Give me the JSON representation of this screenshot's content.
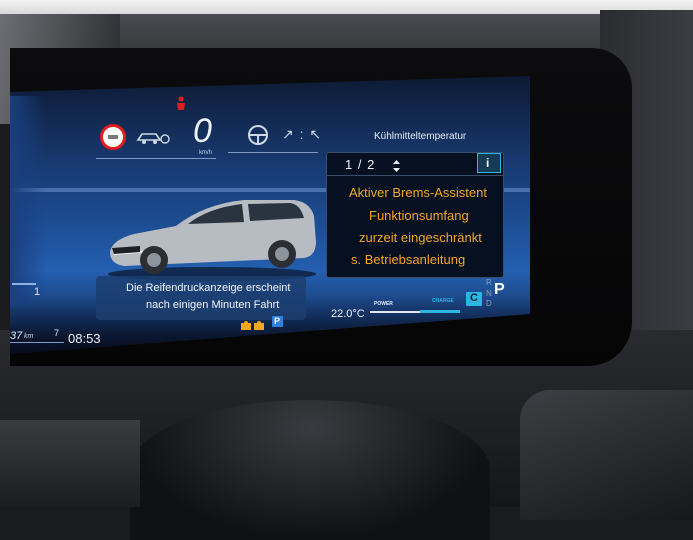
{
  "speed": {
    "value": "0",
    "unit": "km/h"
  },
  "assist_status": "↗ : ↖",
  "header_label": "Kühlmitteltemperatur",
  "message_panel": {
    "page": "1 / 2",
    "info_label": "i",
    "lines": [
      "Aktiver Brems-Assistent",
      "Funktionsumfang",
      "zurzeit eingeschränkt",
      "s. Betriebsanleitung"
    ]
  },
  "tire_notice": {
    "line1": "Die Reifendruckanzeige erscheint",
    "line2": "nach einigen Minuten Fahrt"
  },
  "odometer": {
    "left": "37",
    "unit": "km",
    "trip": "7"
  },
  "left_gauge_digit": "1",
  "clock": "08:53",
  "outside_temp": "22.0°C",
  "bar_labels": {
    "power": "POWER",
    "charge": "CHARGE"
  },
  "drive_mode": "C",
  "gear": {
    "r": "R",
    "n": "N",
    "p": "P",
    "d": "D"
  },
  "parking_label": "P",
  "colors": {
    "amber": "#f5a623",
    "cyan": "#2bb7e4",
    "warning_red": "#e01e1e",
    "screen_blue": "#1b4f9a"
  }
}
